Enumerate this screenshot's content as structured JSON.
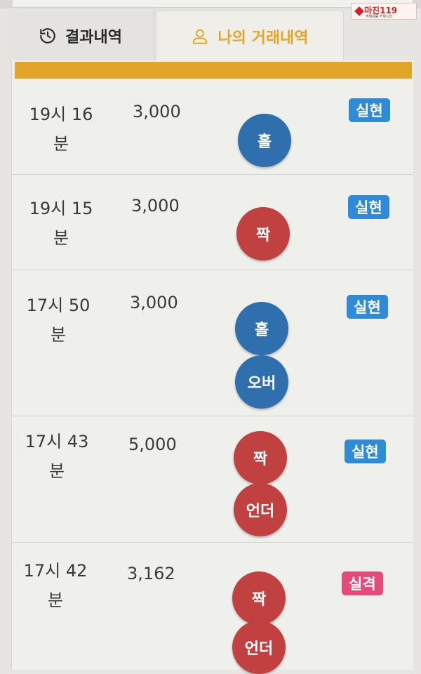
{
  "logo": {
    "title": "마진",
    "suffix": "119",
    "tagline": "먹튀검증 커뮤니티"
  },
  "tabs": {
    "results_label": "결과내역",
    "mine_label": "나의 거래내역"
  },
  "colors": {
    "accent": "#e2a52a",
    "chip_blue": "#2f6fae",
    "chip_red": "#c0413f",
    "badge_success": "#2f8ad8",
    "badge_fail": "#e34b7a"
  },
  "history": [
    {
      "time_line1": "19시 16",
      "time_line2": "분",
      "amount": "3,000",
      "picks": [
        "홀"
      ],
      "result": "실현"
    },
    {
      "time_line1": "19시 15",
      "time_line2": "분",
      "amount": "3,000",
      "picks": [
        "짝"
      ],
      "result": "실현"
    },
    {
      "time_line1": "17시 50",
      "time_line2": "분",
      "amount": "3,000",
      "picks": [
        "홀",
        "오버"
      ],
      "result": "실현"
    },
    {
      "time_line1": "17시 43",
      "time_line2": "분",
      "amount": "5,000",
      "picks": [
        "짝",
        "언더"
      ],
      "result": "실현"
    },
    {
      "time_line1": "17시 42",
      "time_line2": "분",
      "amount": "3,162",
      "picks": [
        "짝",
        "언더"
      ],
      "result": "실격"
    }
  ]
}
